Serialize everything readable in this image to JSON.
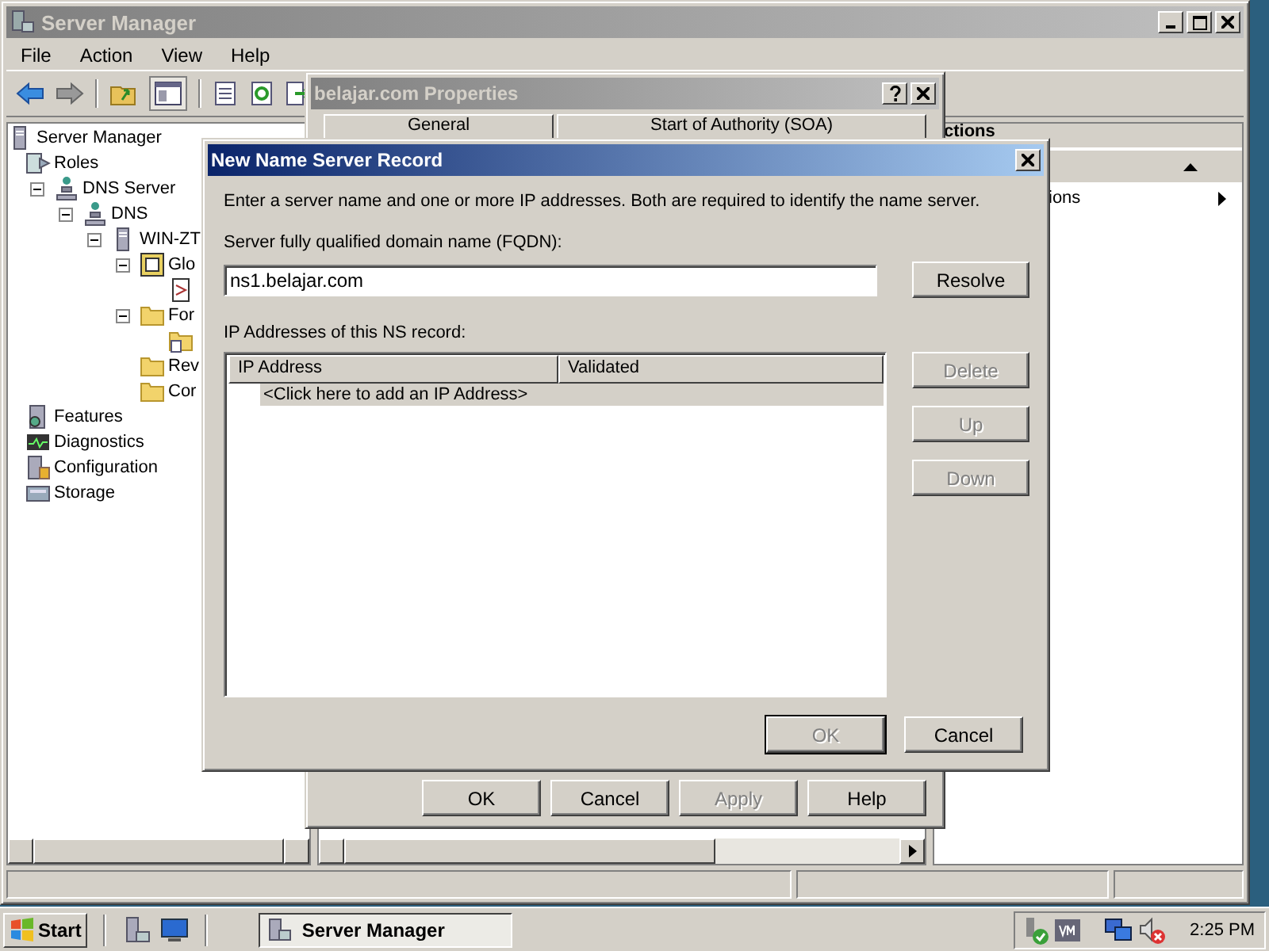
{
  "window": {
    "title": "Server Manager"
  },
  "menu": [
    "File",
    "Action",
    "View",
    "Help"
  ],
  "tree": [
    {
      "label": "Server Manager",
      "kind": "server",
      "children": [
        {
          "label": "Roles",
          "kind": "roles",
          "children": [
            {
              "label": "DNS Server",
              "kind": "network",
              "expanded": true,
              "children": [
                {
                  "label": "DNS",
                  "kind": "network",
                  "expanded": true,
                  "children": [
                    {
                      "label": "WIN-ZT",
                      "kind": "server",
                      "expanded": true,
                      "children": [
                        {
                          "label": "Glo",
                          "kind": "log",
                          "expanded": true,
                          "children": [
                            {
                              "kind": "document"
                            }
                          ]
                        },
                        {
                          "label": "For",
                          "kind": "folder",
                          "expanded": true,
                          "children": [
                            {
                              "kind": "zone"
                            }
                          ]
                        },
                        {
                          "label": "Rev",
                          "kind": "folder"
                        },
                        {
                          "label": "Cor",
                          "kind": "folder"
                        }
                      ]
                    }
                  ]
                }
              ]
            }
          ]
        },
        {
          "label": "Features",
          "kind": "features"
        },
        {
          "label": "Diagnostics",
          "kind": "diagnostics"
        },
        {
          "label": "Configuration",
          "kind": "configuration"
        },
        {
          "label": "Storage",
          "kind": "storage"
        }
      ]
    }
  ],
  "actions": {
    "header": "ctions",
    "item": "ions"
  },
  "properties": {
    "title": "belajar.com Properties",
    "tabs": [
      "General",
      "Start of Authority (SOA)"
    ],
    "buttons": [
      {
        "label": "OK",
        "disabled": false
      },
      {
        "label": "Cancel",
        "disabled": false
      },
      {
        "label": "Apply",
        "disabled": true
      },
      {
        "label": "Help",
        "disabled": false
      }
    ]
  },
  "dialog": {
    "title": "New Name Server Record",
    "intro": "Enter a server name and one or more IP addresses.  Both are required to identify the name server.",
    "fqdn_label": "Server fully qualified domain name (FQDN):",
    "fqdn_value": "ns1.belajar.com",
    "resolve": "Resolve",
    "ip_label": "IP Addresses of this NS record:",
    "columns": [
      "IP Address",
      "Validated"
    ],
    "rows": [
      {
        "text": "<Click here to add an IP Address>",
        "selected": true
      }
    ],
    "side_buttons": [
      {
        "label": "Delete",
        "disabled": true
      },
      {
        "label": "Up",
        "disabled": true
      },
      {
        "label": "Down",
        "disabled": true
      }
    ],
    "buttons": [
      {
        "label": "OK",
        "disabled": true
      },
      {
        "label": "Cancel",
        "disabled": false
      }
    ]
  },
  "taskbar": {
    "start": "Start",
    "tasks": [
      {
        "label": "Server Manager",
        "selected": true
      }
    ],
    "clock": "2:25 PM"
  }
}
